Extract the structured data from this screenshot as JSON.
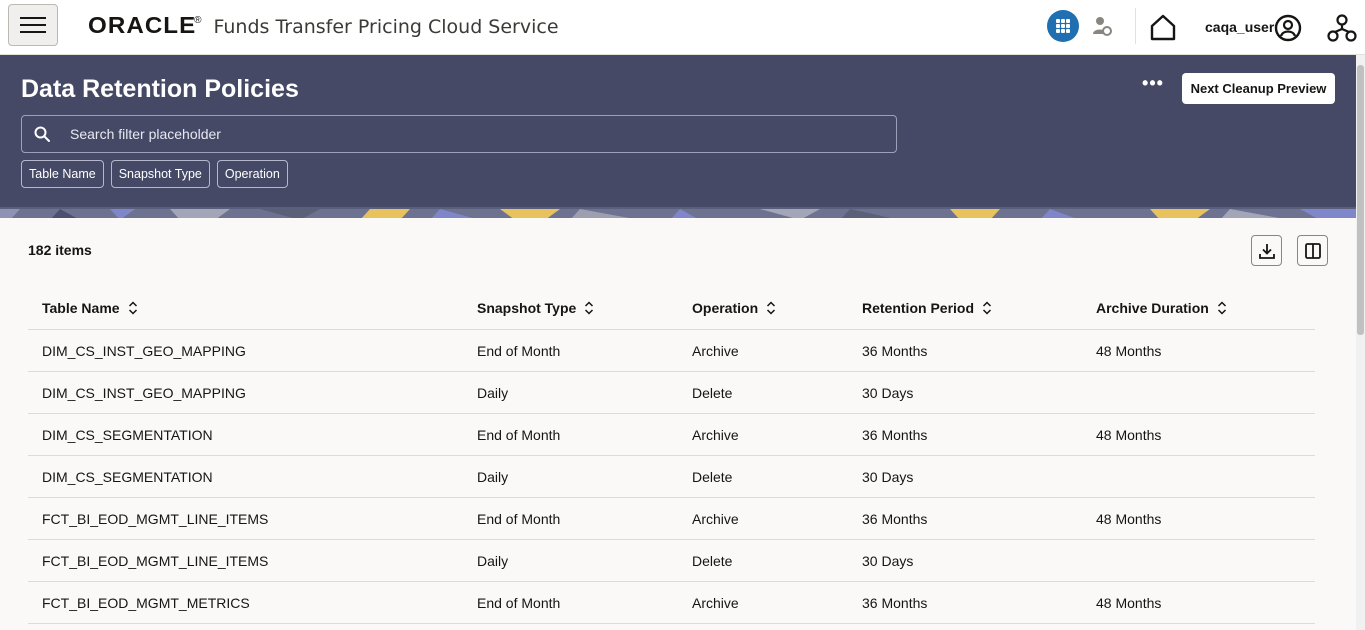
{
  "topbar": {
    "logo": "ORACLE",
    "logo_mark": "®",
    "app_title": "Funds Transfer Pricing Cloud Service",
    "username": "caqa_user"
  },
  "header": {
    "title": "Data Retention Policies",
    "more_label": "•••",
    "cleanup_button": "Next Cleanup Preview",
    "search_placeholder": "Search filter placeholder",
    "filters": [
      "Table Name",
      "Snapshot Type",
      "Operation"
    ]
  },
  "content": {
    "items_count": "182 items"
  },
  "table": {
    "columns": [
      "Table Name",
      "Snapshot Type",
      "Operation",
      "Retention Period",
      "Archive Duration"
    ],
    "rows": [
      [
        "DIM_CS_INST_GEO_MAPPING",
        "End of Month",
        "Archive",
        "36 Months",
        "48 Months"
      ],
      [
        "DIM_CS_INST_GEO_MAPPING",
        "Daily",
        "Delete",
        "30 Days",
        ""
      ],
      [
        "DIM_CS_SEGMENTATION",
        "End of Month",
        "Archive",
        "36 Months",
        "48 Months"
      ],
      [
        "DIM_CS_SEGMENTATION",
        "Daily",
        "Delete",
        "30 Days",
        ""
      ],
      [
        "FCT_BI_EOD_MGMT_LINE_ITEMS",
        "End of Month",
        "Archive",
        "36 Months",
        "48 Months"
      ],
      [
        "FCT_BI_EOD_MGMT_LINE_ITEMS",
        "Daily",
        "Delete",
        "30 Days",
        ""
      ],
      [
        "FCT_BI_EOD_MGMT_METRICS",
        "End of Month",
        "Archive",
        "36 Months",
        "48 Months"
      ]
    ]
  },
  "colors": {
    "header_bg": "#454966",
    "accent": "#1f6fb1",
    "content_bg": "#fbf9f8"
  },
  "icons": [
    "hamburger-icon",
    "grid-icon",
    "person-settings-icon",
    "home-icon",
    "user-avatar-icon",
    "org-chart-icon",
    "search-icon",
    "more-icon",
    "download-icon",
    "columns-icon",
    "sort-icon"
  ]
}
